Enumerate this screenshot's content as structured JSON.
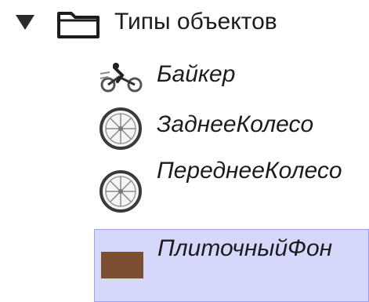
{
  "tree": {
    "folder": {
      "label": "Типы объектов",
      "icon": "folder-icon",
      "expanded": true
    },
    "items": [
      {
        "label": "Байкер",
        "icon": "biker-icon"
      },
      {
        "label": "ЗаднееКолесо",
        "icon": "wheel-icon"
      },
      {
        "label": "ПереднееКолесо",
        "icon": "wheel-icon"
      },
      {
        "label": "ПлиточныйФон",
        "icon": "tile-swatch-icon",
        "selected": true,
        "swatch_color": "#7a4e2f"
      }
    ],
    "colors": {
      "selection_bg": "#d6d8fb",
      "selection_border": "#9ea2ef"
    }
  }
}
